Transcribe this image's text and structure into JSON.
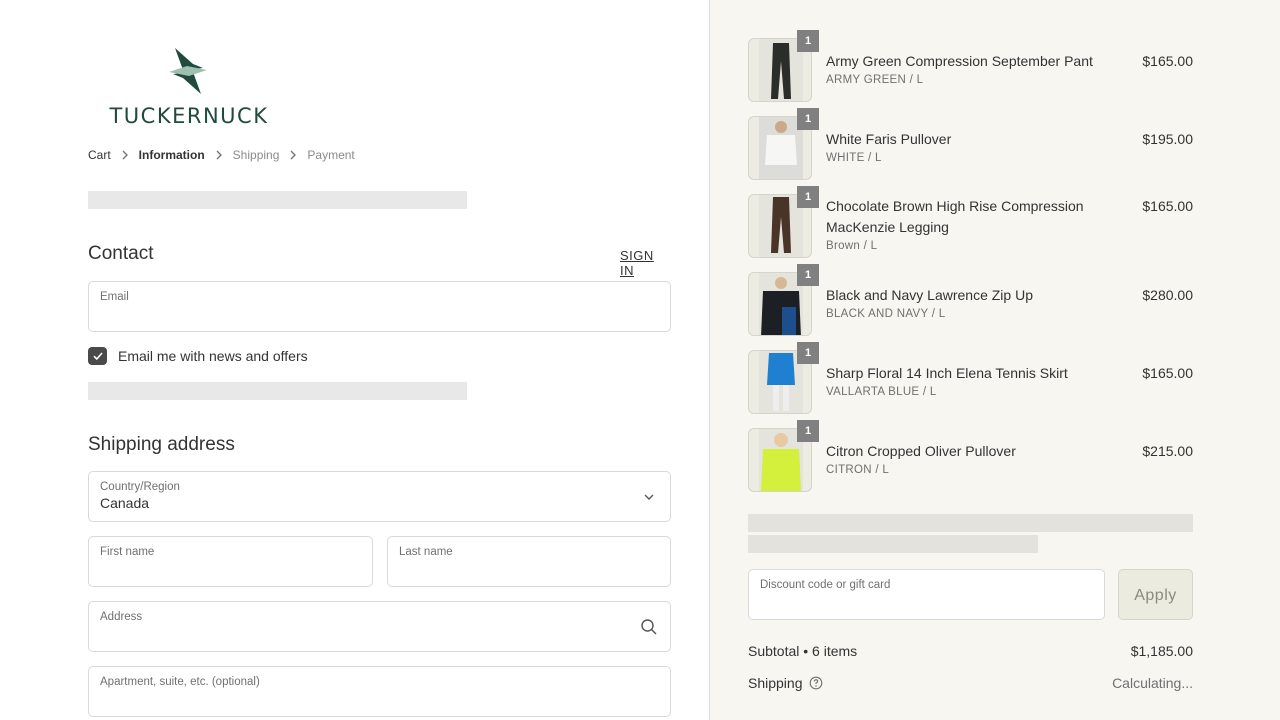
{
  "brand": {
    "name": "TUCKERNUCK",
    "color": "#1f4a3d"
  },
  "breadcrumb": {
    "cart": "Cart",
    "information": "Information",
    "shipping": "Shipping",
    "payment": "Payment"
  },
  "contact": {
    "title": "Contact",
    "sign_in": "SIGN IN",
    "email_label": "Email",
    "email_value": "",
    "newsletter_label": "Email me with news and offers",
    "newsletter_checked": true
  },
  "shipping_address": {
    "title": "Shipping address",
    "country_label": "Country/Region",
    "country_value": "Canada",
    "first_name_label": "First name",
    "last_name_label": "Last name",
    "address_label": "Address",
    "apartment_label": "Apartment, suite, etc. (optional)"
  },
  "cart": {
    "items": [
      {
        "name": "Army Green Compression September Pant",
        "variant": "ARMY GREEN / L",
        "price": "$165.00",
        "qty": "1"
      },
      {
        "name": "White Faris Pullover",
        "variant": "WHITE / L",
        "price": "$195.00",
        "qty": "1"
      },
      {
        "name": "Chocolate Brown High Rise Compression MacKenzie Legging",
        "variant": "Brown / L",
        "price": "$165.00",
        "qty": "1"
      },
      {
        "name": "Black and Navy Lawrence Zip Up",
        "variant": "BLACK AND NAVY / L",
        "price": "$280.00",
        "qty": "1"
      },
      {
        "name": "Sharp Floral 14 Inch Elena Tennis Skirt",
        "variant": "VALLARTA BLUE / L",
        "price": "$165.00",
        "qty": "1"
      },
      {
        "name": "Citron Cropped Oliver Pullover",
        "variant": "CITRON / L",
        "price": "$215.00",
        "qty": "1"
      }
    ],
    "discount_label": "Discount code or gift card",
    "apply_label": "Apply",
    "subtotal_label": "Subtotal • 6 items",
    "subtotal_value": "$1,185.00",
    "shipping_label": "Shipping",
    "shipping_value": "Calculating..."
  }
}
